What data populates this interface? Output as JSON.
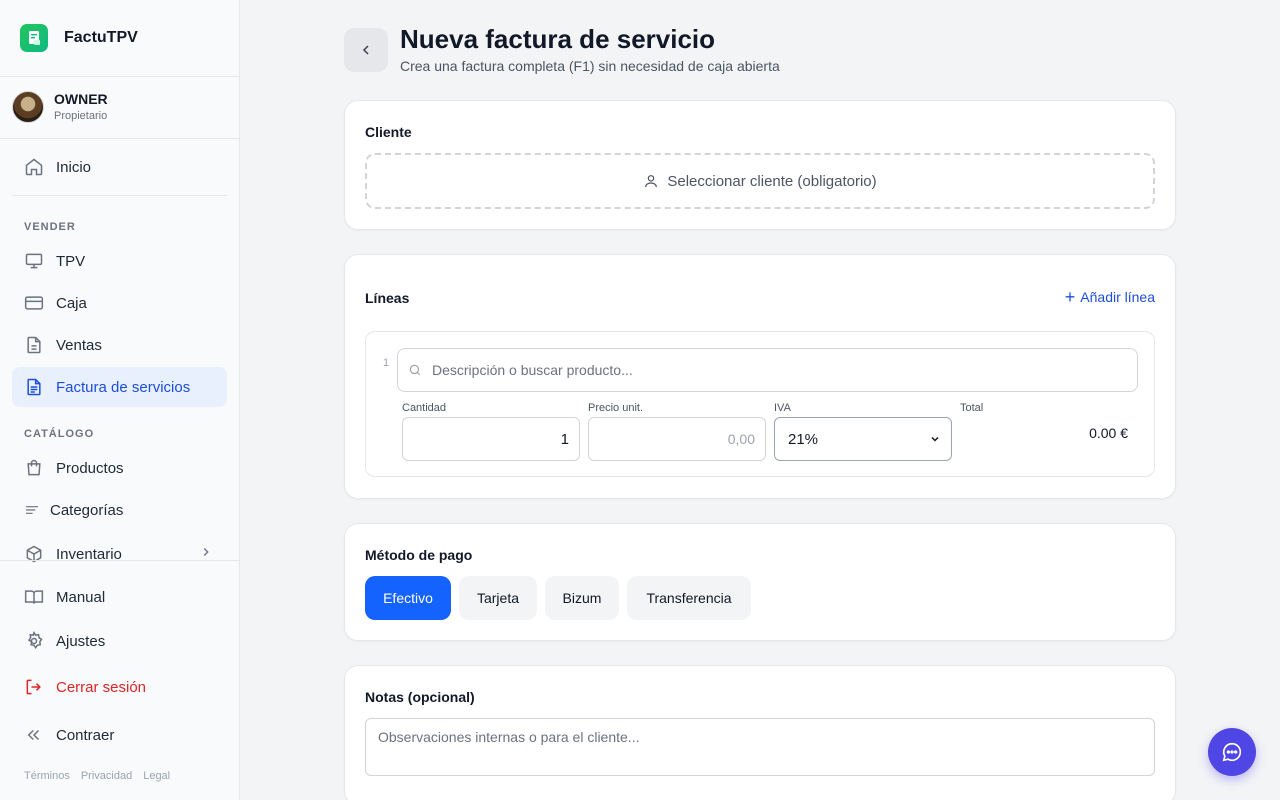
{
  "app": {
    "name": "FactuTPV",
    "accent": "#1463ff",
    "brand_color": "#22c55e"
  },
  "user": {
    "name": "OWNER",
    "role": "Propietario"
  },
  "sidebar": {
    "home": {
      "label": "Inicio",
      "icon": "home-icon"
    },
    "sections": [
      {
        "label": "VENDER",
        "items": [
          {
            "label": "TPV",
            "icon": "monitor-icon"
          },
          {
            "label": "Caja",
            "icon": "credit-card-icon"
          },
          {
            "label": "Ventas",
            "icon": "file-icon"
          },
          {
            "label": "Factura de servicios",
            "icon": "file-text-icon",
            "active": true
          }
        ]
      },
      {
        "label": "CATÁLOGO",
        "items": [
          {
            "label": "Productos",
            "icon": "shopping-bag-icon"
          },
          {
            "label": "Categorías",
            "icon": "list-icon"
          },
          {
            "label": "Inventario",
            "icon": "package-icon",
            "has_submenu": true
          }
        ]
      }
    ],
    "bottom": [
      {
        "label": "Manual",
        "icon": "book-icon"
      },
      {
        "label": "Ajustes",
        "icon": "gear-icon"
      },
      {
        "label": "Cerrar sesión",
        "icon": "logout-icon",
        "danger": true
      },
      {
        "label": "Contraer",
        "icon": "chevrons-left-icon"
      }
    ],
    "footer_links": [
      "Términos",
      "Privacidad",
      "Legal"
    ]
  },
  "page": {
    "title": "Nueva factura de servicio",
    "subtitle": "Crea una factura completa (F1) sin necesidad de caja abierta"
  },
  "client_card": {
    "title": "Cliente",
    "select_label": "Seleccionar cliente (obligatorio)"
  },
  "lines_card": {
    "title": "Líneas",
    "add_label": "Añadir línea",
    "lines": [
      {
        "number": "1",
        "description_placeholder": "Descripción o buscar producto...",
        "quantity_label": "Cantidad",
        "quantity_value": "1",
        "price_label": "Precio unit.",
        "price_placeholder": "0,00",
        "iva_label": "IVA",
        "iva_value": "21%",
        "total_label": "Total",
        "total_value": "0.00 €"
      }
    ]
  },
  "payment_card": {
    "title": "Método de pago",
    "methods": [
      "Efectivo",
      "Tarjeta",
      "Bizum",
      "Transferencia"
    ],
    "selected": "Efectivo"
  },
  "notes_card": {
    "title": "Notas (opcional)",
    "placeholder": "Observaciones internas o para el cliente..."
  }
}
